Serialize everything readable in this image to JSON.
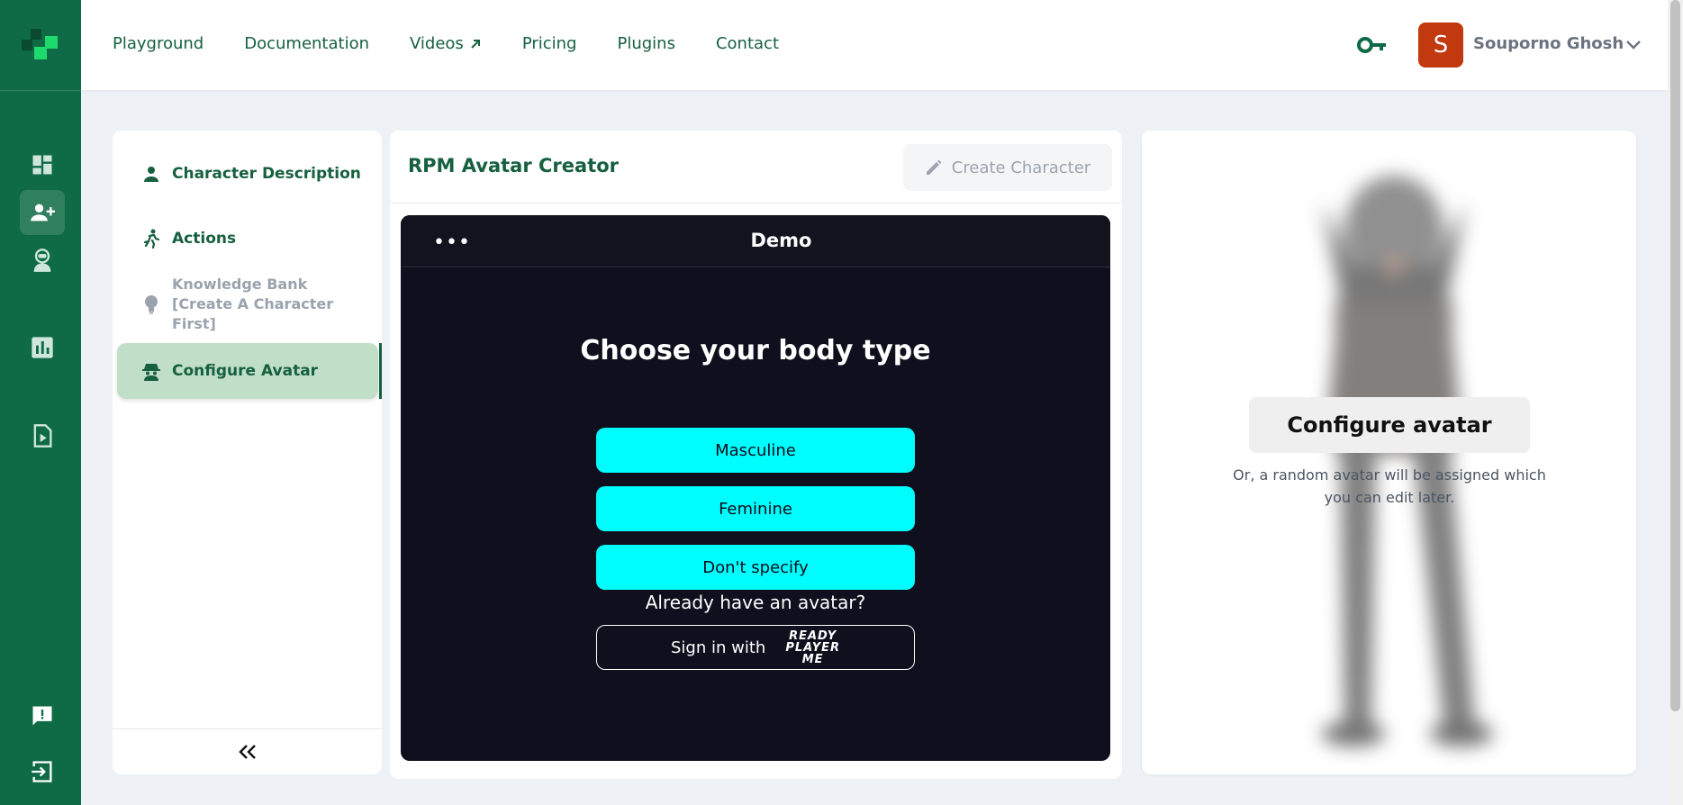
{
  "nav": {
    "items": [
      {
        "label": "Playground"
      },
      {
        "label": "Documentation"
      },
      {
        "label": "Videos",
        "external_icon": "arrow-up-right-icon"
      },
      {
        "label": "Pricing"
      },
      {
        "label": "Plugins"
      },
      {
        "label": "Contact"
      }
    ]
  },
  "user": {
    "initial": "S",
    "name": "Souporno Ghosh",
    "avatar_color": "#c2380f"
  },
  "sidebar": {
    "rail_icons": [
      "dashboard-icon",
      "add-user-icon",
      "character-icon",
      "analytics-icon",
      "video-file-icon",
      "feedback-icon",
      "logout-icon"
    ],
    "active_icon": "add-user-icon"
  },
  "steps": [
    {
      "label": "Character Description",
      "icon": "person-icon",
      "state": "enabled"
    },
    {
      "label": "Actions",
      "icon": "running-icon",
      "state": "enabled"
    },
    {
      "label": "Knowledge Bank [Create A Character First]",
      "icon": "lightbulb-icon",
      "state": "disabled"
    },
    {
      "label": "Configure Avatar",
      "icon": "spy-icon",
      "state": "active"
    }
  ],
  "collapse_label": "«",
  "editor": {
    "title": "RPM Avatar Creator",
    "create_button": "Create Character"
  },
  "demo": {
    "title": "Demo",
    "menu_glyph": "•••",
    "heading": "Choose your body type",
    "options": [
      "Masculine",
      "Feminine",
      "Don't specify"
    ],
    "already_text": "Already have an avatar?",
    "signin_text": "Sign in with",
    "rpm_logo": [
      "READY",
      "PLAYER",
      "ME"
    ]
  },
  "preview": {
    "configure_button": "Configure avatar",
    "note": "Or, a random avatar will be assigned which you can edit later."
  },
  "colors": {
    "brand": "#0e6b45",
    "brand_text": "#16603f",
    "accent_cyan": "#00fdfd",
    "active_step_bg": "#c1dfc8"
  }
}
